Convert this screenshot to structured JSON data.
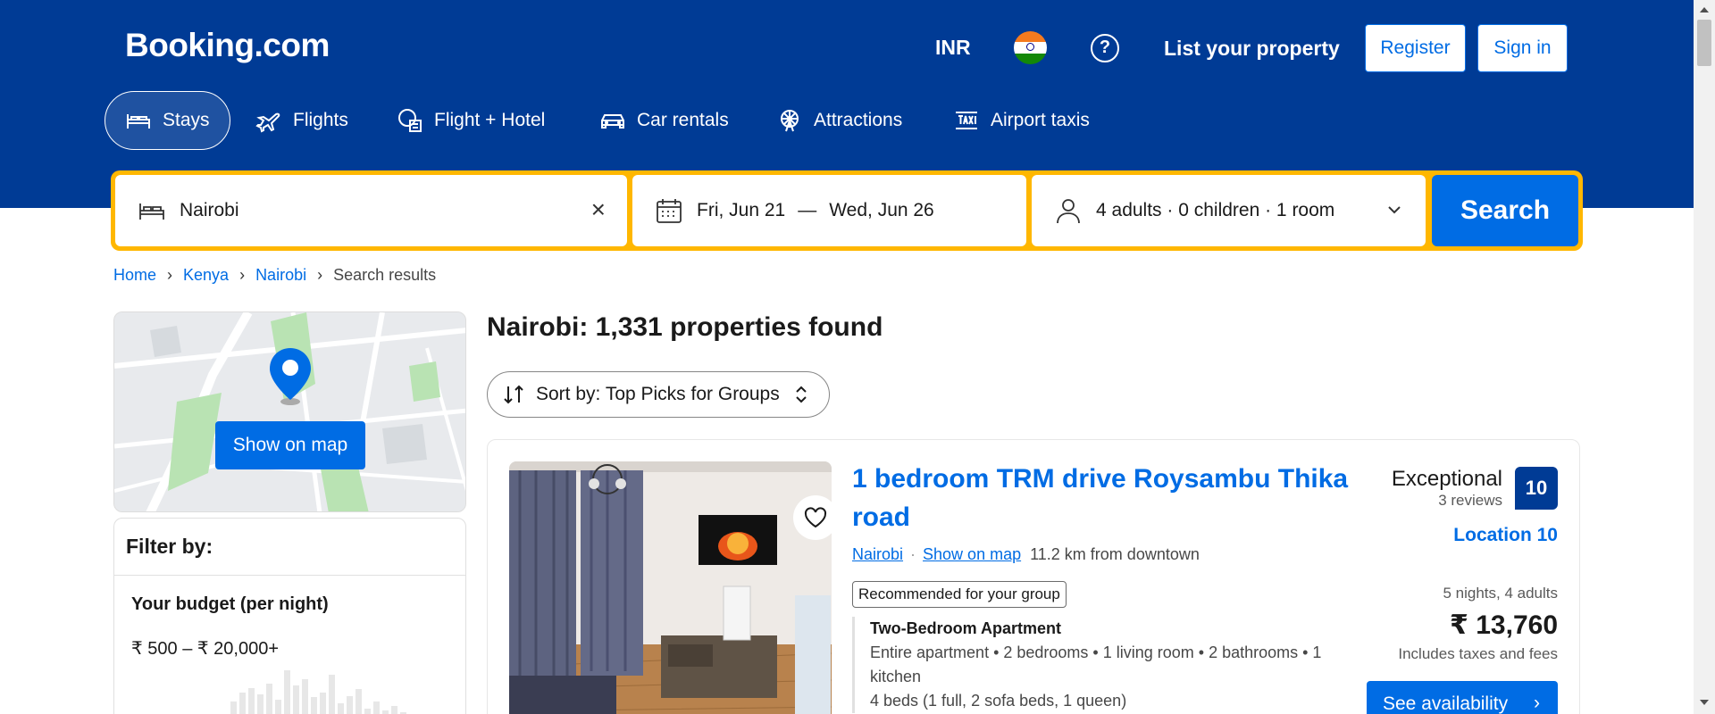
{
  "header": {
    "logo": "Booking.com",
    "currency": "INR",
    "help": "?",
    "list_property": "List your property",
    "register": "Register",
    "sign_in": "Sign in",
    "brand_color": "#003b95",
    "accent_color": "#006ce4"
  },
  "nav": {
    "tabs": [
      {
        "label": "Stays",
        "icon": "bed-icon",
        "active": true
      },
      {
        "label": "Flights",
        "icon": "plane-icon"
      },
      {
        "label": "Flight + Hotel",
        "icon": "flight-hotel-icon"
      },
      {
        "label": "Car rentals",
        "icon": "car-icon"
      },
      {
        "label": "Attractions",
        "icon": "ferris-wheel-icon"
      },
      {
        "label": "Airport taxis",
        "icon": "taxi-icon"
      }
    ]
  },
  "search": {
    "destination": "Nairobi",
    "check_in": "Fri, Jun 21",
    "date_separator": "—",
    "check_out": "Wed, Jun 26",
    "guests": "4 adults · 0 children · 1 room",
    "button": "Search",
    "border_color": "#ffb700"
  },
  "breadcrumb": {
    "items": [
      "Home",
      "Kenya",
      "Nairobi"
    ],
    "current": "Search results"
  },
  "map": {
    "button": "Show on map"
  },
  "filters": {
    "title": "Filter by:",
    "budget_title": "Your budget (per night)",
    "budget_range": "₹ 500 – ₹ 20,000+"
  },
  "results": {
    "title": "Nairobi: 1,331 properties found",
    "sort_label": "Sort by: Top Picks for Groups"
  },
  "listing": {
    "title": "1 bedroom TRM drive Roysambu Thika road",
    "location_link": "Nairobi",
    "show_on_map": "Show on map",
    "distance": "11.2 km from downtown",
    "badge": "Recommended for your group",
    "unit_name": "Two-Bedroom Apartment",
    "unit_desc": "Entire apartment • 2 bedrooms • 1 living room • 2 bathrooms • 1 kitchen",
    "beds": "4 beds (1 full, 2 sofa beds, 1 queen)",
    "rating_word": "Exceptional",
    "reviews": "3 reviews",
    "score": "10",
    "location_score": "Location 10",
    "stay_meta": "5 nights, 4 adults",
    "price": "₹ 13,760",
    "taxes": "Includes taxes and fees",
    "cta": "See availability"
  }
}
